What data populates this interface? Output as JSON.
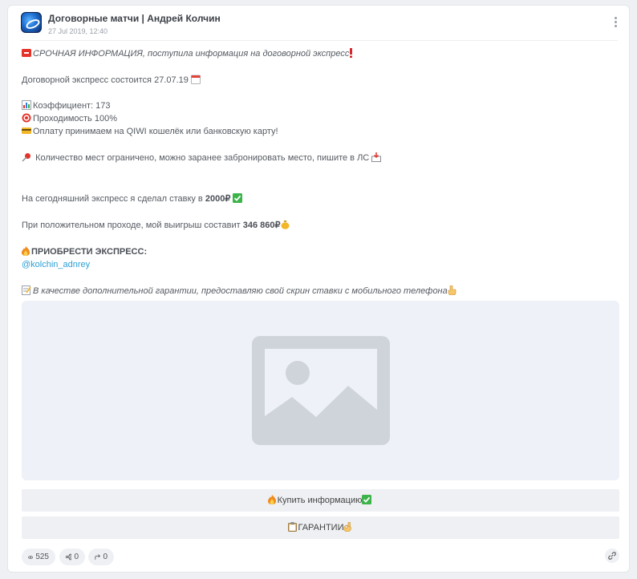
{
  "channel": {
    "title": "Договорные матчи | Андрей Колчин",
    "date": "27 Jul 2019, 12:40"
  },
  "post": {
    "line1": "СРОЧНАЯ ИНФОРМАЦИЯ, поступила информация на договорной экспресс",
    "line2": "Договорной экспресс состоится 27.07.19",
    "line3": "Коэффициент: 173",
    "line4": "Проходимость 100%",
    "line5": "Оплату принимаем на QIWI кошелёк или банковскую карту!",
    "line6": "Количество мест ограничено, можно заранее забронировать место, пишите в ЛС",
    "line7_pre": "На сегодняшний экспресс я сделал ставку в ",
    "line7_amount": "2000₽",
    "line8_pre": "При положительном проходе, мой выигрыш составит ",
    "line8_amount": "346 860₽",
    "line9": "ПРИОБРЕСТИ ЭКСПРЕСС:",
    "line10": "@kolchin_adnrey",
    "line11": "В качестве дополнительной гарантии, предоставляю свой скрин ставки с мобильного телефона"
  },
  "buttons": {
    "buy": "Купить информацию",
    "guarantee": "ГАРАНТИИ"
  },
  "stats": {
    "views": "525",
    "shares": "0",
    "forwards": "0"
  },
  "colors": {
    "accent_link": "#2a9fd6",
    "placeholder": "#cfd3da"
  }
}
